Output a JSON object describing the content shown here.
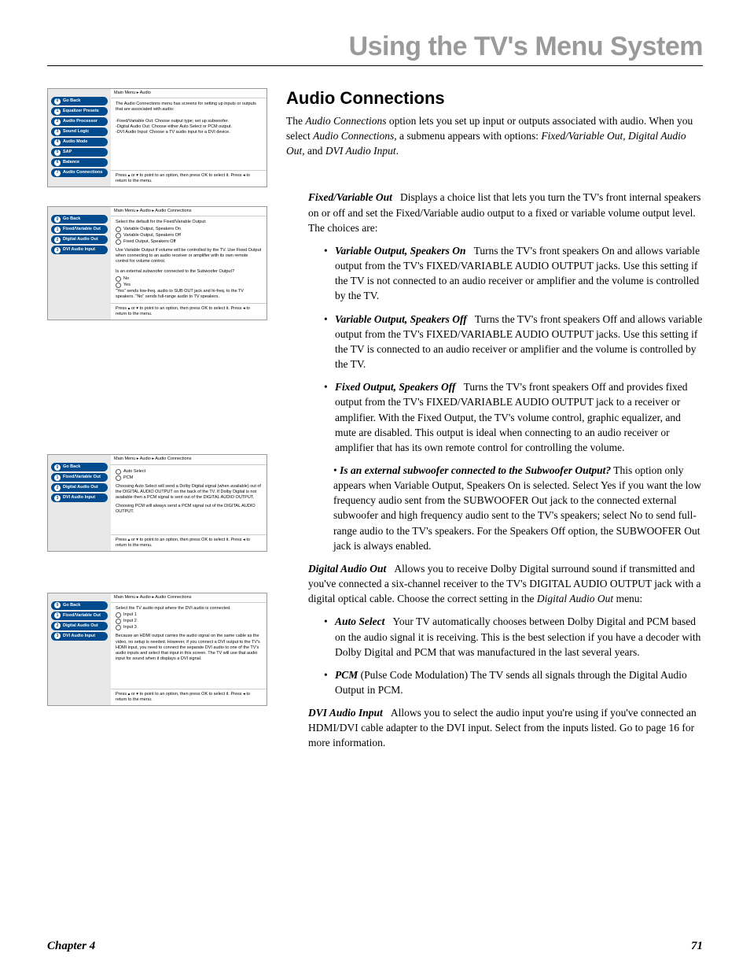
{
  "pageTitle": "Using the TV's Menu System",
  "section": "Audio Connections",
  "intro": "The Audio Connections option lets you set up input or outputs associated with audio. When you select Audio Connections, a submenu appears with options: Fixed/Variable Out, Digital Audio Out, and DVI Audio Input.",
  "menus": {
    "audio": {
      "crumb": "Main Menu ▸ Audio",
      "items": [
        "Go Back",
        "Equalizer Presets",
        "Audio Processor",
        "Sound Logic",
        "Audio Mode",
        "SAP",
        "Balance",
        "Audio Connections"
      ],
      "body1": "The Audio Connections menu has screens for setting up inputs or outputs that are associated with audio:",
      "body2": "-Fixed/Variable Out: Choose output type; set up subwoofer.\n-Digital Audio Out: Choose either Auto Select or PCM output.\n-DVI Audio Input: Choose a TV audio input for a DVI device.",
      "foot": "Press ▴ or ▾ to point to an option, then press OK to select it. Press ◂ to return to the menu."
    },
    "fvo": {
      "crumb": "Main Menu ▸ Audio ▸ Audio Connections",
      "items": [
        "Go Back",
        "Fixed/Variable Out",
        "Digital Audio Out",
        "DVI Audio Input"
      ],
      "heading": "Select the default for the Fixed/Variable Output:",
      "opts": [
        "Variable Output, Speakers On",
        "Variable Output, Speakers Off",
        "Fixed Output, Speakers Off"
      ],
      "body": "Use Variable Output if volume will be controlled by the TV. Use Fixed Output when connecting to an audio receiver or amplifier with its own remote control for volume control.",
      "sub": "Is an external subwoofer connected to the Subwoofer Output?",
      "subopts": [
        "No",
        "Yes"
      ],
      "subtext": "\"Yes\" sends low-freq. audio to SUB OUT jack and hi-freq. to the TV speakers. \"No\" sends full-range audio to TV speakers.",
      "foot": "Press ▴ or ▾ to point to an option, then press OK to select it. Press ◂ to return to the menu."
    },
    "dao": {
      "crumb": "Main Menu ▸ Audio ▸ Audio Connections",
      "items": [
        "Go Back",
        "Fixed/Variable Out",
        "Digital Audio Out",
        "DVI Audio Input"
      ],
      "opts": [
        "Auto Select",
        "PCM"
      ],
      "body1": "Choosing Auto Select will send a Dolby Digital signal (when available) out of the DIGITAL AUDIO OUTPUT on the back of the TV. If Dolby Digital is not available then a PCM signal is sent out of the DIGITAL AUDIO OUTPUT.",
      "body2": "Choosing PCM will always send a PCM signal out of the DIGITAL AUDIO OUTPUT.",
      "foot": "Press ▴ or ▾ to point to an option, then press OK to select it. Press ◂ to return to the menu."
    },
    "dvi": {
      "crumb": "Main Menu ▸ Audio ▸ Audio Connections",
      "items": [
        "Go Back",
        "Fixed/Variable Out",
        "Digital Audio Out",
        "DVI Audio Input"
      ],
      "heading": "Select the TV audio input where the DVI audio is connected.",
      "opts": [
        "Input 1",
        "Input 2",
        "Input 3"
      ],
      "body": "Because an HDMI output carries the audio signal on the same cable as the video, no setup is needed. However, if you connect a DVI output to the TV's HDMI input, you need to connect the separate DVI audio to one of the TV's audio inputs and select that input in this screen. The TV will use that audio input for sound when it displays a DVI signal.",
      "foot": "Press ▴ or ▾ to point to an option, then press OK to select it. Press ◂ to return to the menu."
    }
  },
  "fvo": {
    "lead": "Displays a choice list that lets you turn the TV's front internal speakers on or off and set the Fixed/Variable audio output to a fixed or variable volume output level. The choices are:",
    "li1": "Turns the TV's front speakers On and allows variable output from the TV's FIXED/VARIABLE AUDIO OUTPUT jacks. Use this setting if the TV is not connected to an audio receiver or amplifier and the volume is controlled by the TV.",
    "li2": "Turns the TV's front speakers Off and allows variable output from the TV's FIXED/VARIABLE AUDIO OUTPUT jacks. Use this setting if the TV is connected to an audio receiver or amplifier and the volume is controlled by the TV.",
    "li3": "Turns the TV's front speakers Off and provides fixed output from the TV's FIXED/VARIABLE AUDIO OUTPUT jack to a receiver or amplifier. With the Fixed Output, the TV's volume control, graphic equalizer, and mute are disabled. This output is ideal when connecting to an audio receiver or amplifier that has its own remote control for controlling the volume.",
    "li4": "This option only appears when Variable Output, Speakers On is selected. Select Yes if you want the low frequency audio sent from the SUBWOOFER Out jack to the connected external subwoofer and high frequency audio sent to the TV's speakers; select No to send full-range audio to the TV's speakers. For the Speakers Off option, the SUBWOOFER Out jack is always enabled."
  },
  "dao": {
    "lead": "Allows you to receive Dolby Digital surround sound if transmitted and you've connected a six-channel receiver to the TV's DIGITAL AUDIO OUTPUT jack with a digital optical cable. Choose the correct setting in the Digital Audio Out menu:",
    "li1": "Your TV automatically chooses between Dolby Digital and PCM based on the audio signal it is receiving. This is the best selection if you have a decoder with Dolby Digital and PCM that was manufactured in the last several years.",
    "li2": "(Pulse Code Modulation)  The TV sends all signals through the Digital Audio Output in PCM."
  },
  "dvi": {
    "lead": "Allows you to select the audio input you're using if you've connected an HDMI/DVI cable adapter to the DVI input. Select from the inputs listed. Go to page 16 for more information."
  },
  "labels": {
    "fvo": "Fixed/Variable Out",
    "vso": "Variable Output, Speakers On",
    "vsoff": "Variable Output, Speakers Off",
    "fso": "Fixed Output, Speakers Off",
    "sub": "Is an external subwoofer connected to the Subwoofer Output?",
    "dao": "Digital Audio Out",
    "auto": "Auto Select",
    "pcm": "PCM",
    "dvi": "DVI Audio Input"
  },
  "footer": {
    "chapter": "Chapter 4",
    "page": "71"
  }
}
